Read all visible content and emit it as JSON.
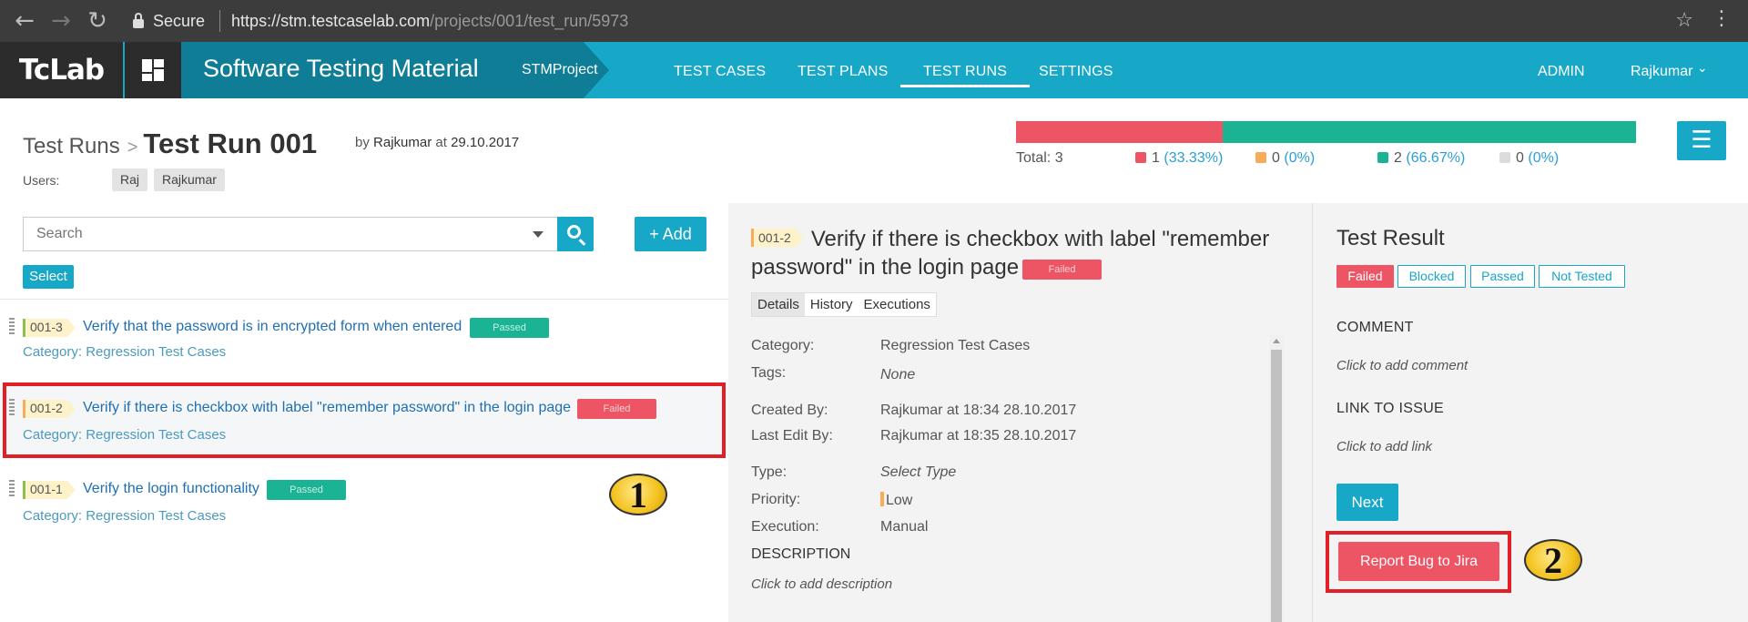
{
  "browser": {
    "back_icon": "←",
    "forward_icon": "→",
    "reload_icon": "↻",
    "secure_label": "Secure",
    "url_host": "https://stm.testcaselab.com",
    "url_path": "/projects/001/test_run/5973",
    "star_icon": "☆",
    "menu_icon": "⋮"
  },
  "app": {
    "logo": "TcLab",
    "brand_title": "Software Testing Material",
    "project": "STMProject",
    "nav": [
      "TEST CASES",
      "TEST PLANS",
      "TEST RUNS",
      "SETTINGS"
    ],
    "active_nav": "TEST RUNS",
    "admin": "ADMIN",
    "user": "Rajkumar",
    "user_caret": "⌄",
    "colors": {
      "accent": "#17a7c7",
      "dark_accent": "#107d97",
      "failed": "#ed5565",
      "passed": "#1ab394",
      "blocked": "#f8ac59"
    }
  },
  "header": {
    "breadcrumb_root": "Test Runs",
    "breadcrumb_sep": ">",
    "title": "Test Run 001",
    "by_prefix": "by",
    "author": "Rajkumar",
    "at_word": "at",
    "date": "29.10.2017",
    "users_label": "Users:",
    "users": [
      "Raj",
      "Rajkumar"
    ]
  },
  "summary": {
    "total_label": "Total: 3",
    "failed_fraction": 0.3333,
    "passed_fraction": 0.6667,
    "failed": {
      "count": "1",
      "pct": "(33.33%)"
    },
    "blocked": {
      "count": "0",
      "pct": "(0%)"
    },
    "passed": {
      "count": "2",
      "pct": "(66.67%)"
    },
    "not_tested": {
      "count": "0",
      "pct": "(0%)"
    },
    "menu_icon": "☰"
  },
  "list": {
    "search_placeholder": "Search",
    "add_label": "+ Add",
    "select_label": "Select",
    "category_prefix": "Category:",
    "items": [
      {
        "id": "001-3",
        "title": "Verify that the password is in encrypted form when entered",
        "status": "Passed",
        "category": "Regression Test Cases"
      },
      {
        "id": "001-2",
        "title": "Verify if there is checkbox with label \"remember password\" in the login page",
        "status": "Failed",
        "category": "Regression Test Cases"
      },
      {
        "id": "001-1",
        "title": "Verify the login functionality",
        "status": "Passed",
        "category": "Regression Test Cases"
      }
    ]
  },
  "annotations": {
    "one": "1",
    "two": "2"
  },
  "detail": {
    "id": "001-2",
    "title": "Verify if there is checkbox with label \"remember password\" in the login page",
    "status": "Failed",
    "tabs": [
      "Details",
      "History",
      "Executions"
    ],
    "fields": {
      "category_label": "Category:",
      "category": "Regression Test Cases",
      "tags_label": "Tags:",
      "tags": "None",
      "created_label": "Created By:",
      "created": "Rajkumar at 18:34 28.10.2017",
      "edited_label": "Last Edit By:",
      "edited": "Rajkumar at 18:35 28.10.2017",
      "type_label": "Type:",
      "type": "Select Type",
      "priority_label": "Priority:",
      "priority": "Low",
      "execution_label": "Execution:",
      "execution": "Manual"
    },
    "description_label": "DESCRIPTION",
    "description_placeholder": "Click to add description"
  },
  "result": {
    "title": "Test Result",
    "buttons": [
      "Failed",
      "Blocked",
      "Passed",
      "Not Tested"
    ],
    "comment_label": "COMMENT",
    "comment_placeholder": "Click to add comment",
    "link_label": "LINK TO ISSUE",
    "link_placeholder": "Click to add link",
    "next_label": "Next",
    "jira_label": "Report Bug to Jira"
  }
}
